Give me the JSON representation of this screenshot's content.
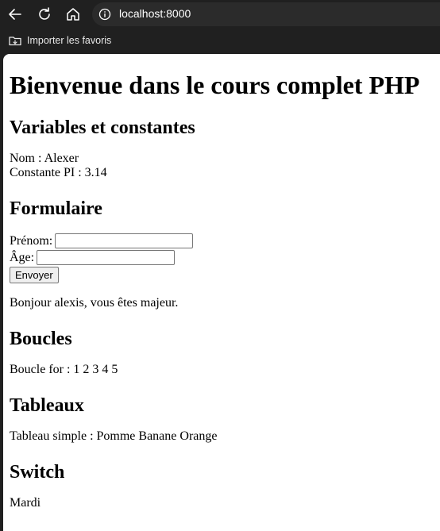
{
  "browser": {
    "url": "localhost:8000",
    "favorites_label": "Importer les favoris"
  },
  "page": {
    "title": "Bienvenue dans le cours complet PHP",
    "sections": {
      "variables": {
        "heading": "Variables et constantes",
        "name_line": "Nom : Alexer",
        "const_line": "Constante PI : 3.14"
      },
      "form": {
        "heading": "Formulaire",
        "firstname_label": "Prénom:",
        "firstname_value": "",
        "age_label": "Âge:",
        "age_value": "",
        "submit_label": "Envoyer",
        "result": "Bonjour alexis, vous êtes majeur."
      },
      "loops": {
        "heading": "Boucles",
        "text": "Boucle for : 1 2 3 4 5"
      },
      "arrays": {
        "heading": "Tableaux",
        "text": "Tableau simple : Pomme Banane Orange"
      },
      "switch": {
        "heading": "Switch",
        "text": "Mardi"
      }
    }
  }
}
